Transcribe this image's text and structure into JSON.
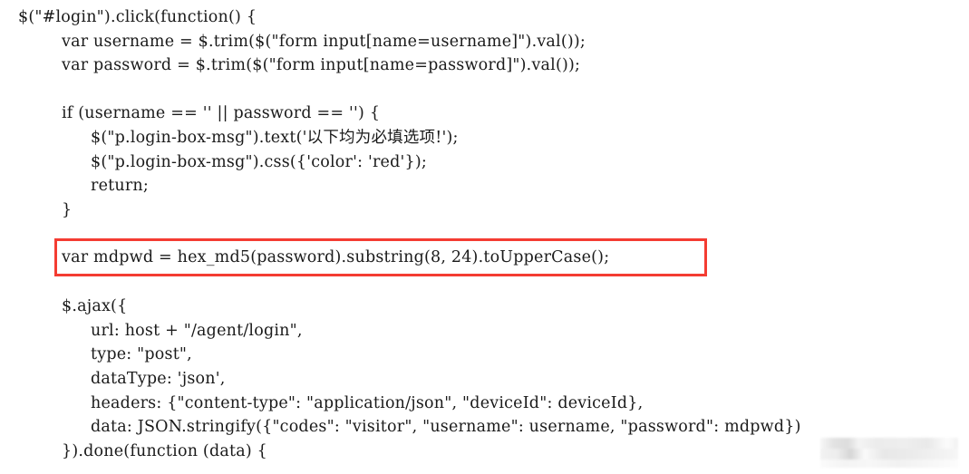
{
  "figure": {
    "title": "jQuery login click handler code snippet",
    "background_color": "#ffffff",
    "text_color": "#1a1a1a",
    "highlight_border_color": "#f43c32"
  },
  "code": {
    "language": "javascript",
    "lines": [
      {
        "indent": 0,
        "text": "$(\"#login\").click(function() {"
      },
      {
        "indent": 1,
        "text": "var username = $.trim($(\"form input[name=username]\").val());"
      },
      {
        "indent": 1,
        "text": "var password = $.trim($(\"form input[name=password]\").val());"
      },
      {
        "indent": 0,
        "text": ""
      },
      {
        "indent": 1,
        "text": "if (username == '' || password == '') {"
      },
      {
        "indent": 2,
        "text": "$(\"p.login-box-msg\").text('以下均为必填选项!');"
      },
      {
        "indent": 2,
        "text": "$(\"p.login-box-msg\").css({'color': 'red'});"
      },
      {
        "indent": 2,
        "text": "return;"
      },
      {
        "indent": 1,
        "text": "}"
      },
      {
        "indent": 0,
        "text": ""
      }
    ],
    "highlighted_line": {
      "indent": 1,
      "text": "var mdpwd = hex_md5(password).substring(8, 24).toUpperCase();"
    },
    "lines_after": [
      {
        "indent": 0,
        "text": ""
      },
      {
        "indent": 1,
        "text": "$.ajax({"
      },
      {
        "indent": 2,
        "text": "url: host + \"/agent/login\","
      },
      {
        "indent": 2,
        "text": "type: \"post\","
      },
      {
        "indent": 2,
        "text": "dataType: 'json',"
      },
      {
        "indent": 2,
        "text": "headers: {\"content-type\": \"application/json\", \"deviceId\": deviceId},"
      },
      {
        "indent": 2,
        "text": "data: JSON.stringify({\"codes\": \"visitor\", \"username\": username, \"password\": mdpwd})"
      },
      {
        "indent": 1,
        "text": "}).done(function (data) {"
      }
    ]
  },
  "watermark": {
    "description": "blurred mosaic watermark",
    "visible_text": ""
  }
}
